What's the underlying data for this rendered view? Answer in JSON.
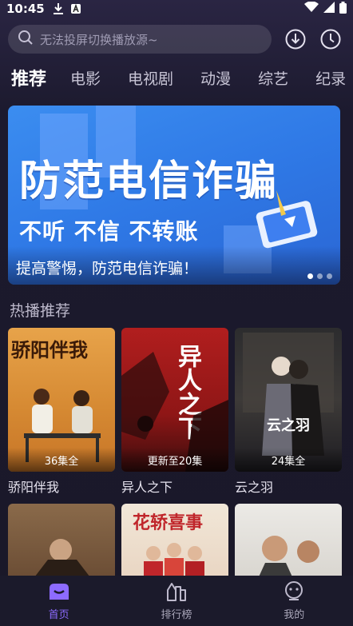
{
  "status": {
    "time": "10:45"
  },
  "search": {
    "placeholder": "无法投屏切换播放源~"
  },
  "tabs": [
    "推荐",
    "电影",
    "电视剧",
    "动漫",
    "综艺",
    "纪录"
  ],
  "banner": {
    "headline": "防范电信诈骗",
    "subline": "不听 不信 不转账",
    "caption": "提高警惕，防范电信诈骗！",
    "dots": 3,
    "active_dot": 0
  },
  "section": {
    "title": "热播推荐"
  },
  "cards": [
    {
      "title": "骄阳伴我",
      "badge": "36集全",
      "poster_text": "骄阳伴我"
    },
    {
      "title": "异人之下",
      "badge": "更新至20集",
      "poster_text": "异人之下"
    },
    {
      "title": "云之羽",
      "badge": "24集全",
      "poster_text": "云之羽"
    }
  ],
  "cards_row2": [
    {
      "poster_text": ""
    },
    {
      "poster_text": "花轿喜事"
    },
    {
      "poster_text": ""
    }
  ],
  "nav": [
    {
      "label": "首页",
      "icon": "home-icon",
      "active": true
    },
    {
      "label": "排行榜",
      "icon": "ranking-icon",
      "active": false
    },
    {
      "label": "我的",
      "icon": "profile-icon",
      "active": false
    }
  ],
  "colors": {
    "accent": "#8d6bff",
    "banner": "#3b8df0",
    "background": "#1c1a2e"
  }
}
